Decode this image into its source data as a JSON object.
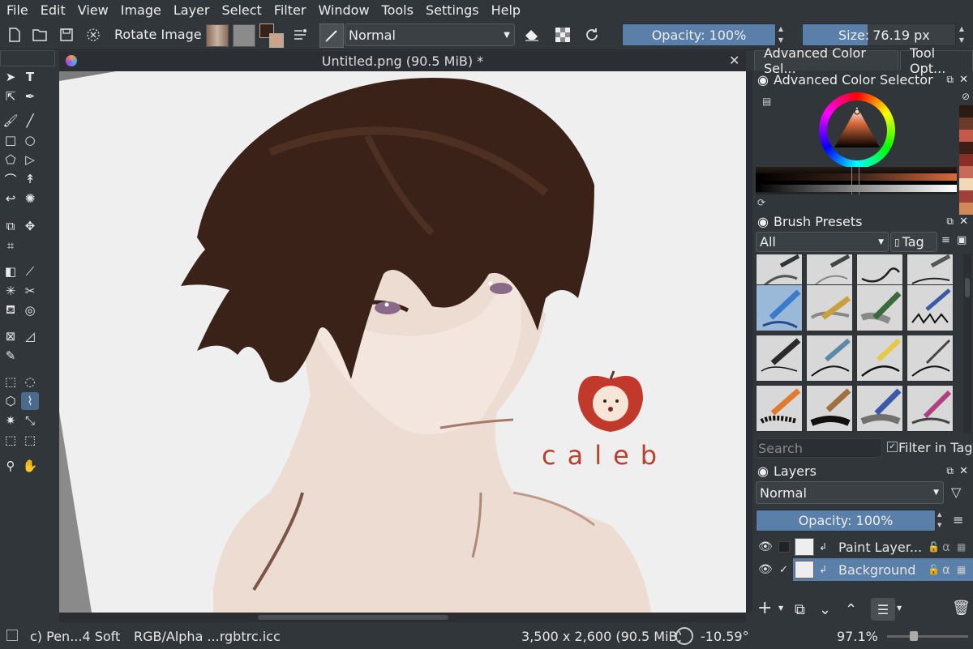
{
  "menu": [
    "File",
    "Edit",
    "View",
    "Image",
    "Layer",
    "Select",
    "Filter",
    "Window",
    "Tools",
    "Settings",
    "Help"
  ],
  "toolbar": {
    "rotate_label": "Rotate Image",
    "blend_mode": "Normal",
    "opacity_label": "Opacity: 100%",
    "opacity_value": 1.0,
    "size_label": "Size:",
    "size_value": "76.19 px"
  },
  "canvas": {
    "tab_title": "Untitled.png (90.5 MiB) *",
    "signature": "caleb"
  },
  "dockers": {
    "tabs": [
      "Advanced Color Sel...",
      "Tool Opt..."
    ],
    "color_selector_title": "Advanced Color Selector",
    "brush_presets_title": "Brush Presets",
    "brush_filter": "All",
    "tag_label": "Tag",
    "search_placeholder": "Search",
    "filter_in_tag": "Filter in Tag",
    "layers_title": "Layers",
    "layer_blend": "Normal",
    "layer_opacity": "Opacity:  100%",
    "layers": [
      {
        "name": "Paint Layer...",
        "visible": true,
        "checked": false,
        "selected": false
      },
      {
        "name": "Background",
        "visible": true,
        "checked": true,
        "selected": true
      }
    ],
    "swatches": [
      "#2c1a14",
      "#6b3a2a",
      "#c45a4a",
      "#3d1f1a",
      "#8a2e28",
      "#c86a5a",
      "#f0d8b8",
      "#a0403a",
      "#d08a5a"
    ]
  },
  "status": {
    "brush": "c) Pen...4 Soft",
    "color_profile": "RGB/Alpha ...rgbtrc.icc",
    "dimensions": "3,500 x 2,600 (90.5 MiB)",
    "rotation": "-10.59°",
    "zoom": "97.1%"
  },
  "colors": {
    "accent": "#5a7fa8",
    "bg": "#31363b",
    "canvas": "#efefef",
    "hair": "#3a2218"
  }
}
